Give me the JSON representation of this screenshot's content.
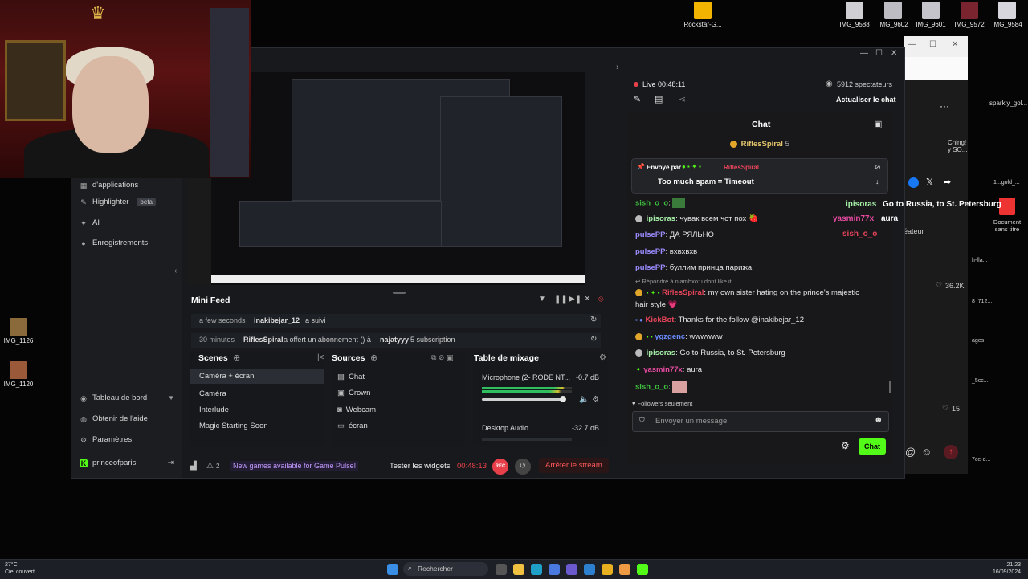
{
  "desktop": {
    "icons_top": [
      {
        "label": "Rockstar-G..."
      },
      {
        "label": "IMG_9588"
      },
      {
        "label": "IMG_9602"
      },
      {
        "label": "IMG_9601"
      },
      {
        "label": "IMG_9572"
      },
      {
        "label": "IMG_9584"
      }
    ],
    "icons_left": [
      {
        "label": "IMG_1126"
      },
      {
        "label": "IMG_1120"
      }
    ],
    "right_doc_label": "Document sans titre",
    "right_user": "sparkly_gol...",
    "right_likes": "36.2K",
    "right_likes2": "15",
    "right_snippets": [
      "Ching! y SO...",
      "éateur",
      "1...gold_...",
      "h-fla...",
      "8_712...",
      "ages",
      "_5cc...",
      "7ce-d..."
    ],
    "right_ellipsis": "···"
  },
  "app": {
    "sidebar": {
      "items": [
        {
          "label": "d'applications"
        },
        {
          "label": "Highlighter",
          "badge": "beta"
        },
        {
          "label": "AI"
        },
        {
          "label": "Enregistrements"
        }
      ],
      "bottom": [
        {
          "label": "Tableau de bord"
        },
        {
          "label": "Obtenir de l'aide"
        },
        {
          "label": "Paramètres"
        },
        {
          "label": "princeofparis"
        }
      ]
    },
    "minifeed": {
      "title": "Mini Feed",
      "entries": [
        {
          "time": "a few seconds",
          "user": "inakibejar_12",
          "action": "a suivi"
        },
        {
          "time": "30 minutes",
          "user": "RiflesSpiral",
          "action": "a offert un abonnement () à",
          "target": "najatyyy",
          "extra": "5 subscription"
        }
      ]
    },
    "scenes": {
      "title": "Scenes",
      "items": [
        "Caméra + écran",
        "Caméra",
        "Interlude",
        "Magic Starting Soon"
      ]
    },
    "sources": {
      "title": "Sources",
      "items": [
        "Chat",
        "Crown",
        "Webcam",
        "écran"
      ]
    },
    "mixer": {
      "title": "Table de mixage",
      "channels": [
        {
          "name": "Microphone (2- RODE NT...",
          "db": "-0.7 dB"
        },
        {
          "name": "Desktop Audio",
          "db": "-32.7 dB"
        }
      ]
    },
    "footer": {
      "viewer_count": "2",
      "news": "New games available for Game Pulse!",
      "test_widgets": "Tester les widgets",
      "timer": "00:48:13",
      "rec": "REC",
      "stop": "Arrêter le stream"
    },
    "live": {
      "status": "Live 00:48:11",
      "viewers": "5912 spectateurs",
      "refresh": "Actualiser le chat"
    },
    "chat": {
      "title": "Chat",
      "top_sub_user": "RiflesSpiral",
      "top_sub_count": "5",
      "pinned_prefix": "Envoyé par",
      "pinned_user": "RiflesSpiral",
      "pinned_message": "Too much spam = Timeout",
      "overlay_right": [
        {
          "user": "ipisoras",
          "text": "Go to Russia, to St. Petersburg"
        },
        {
          "user": "yasmin77x",
          "text": "aura"
        },
        {
          "user": "sish_o_o",
          "text": ""
        }
      ],
      "messages": [
        {
          "user": "sish_o_o",
          "text": "",
          "color": "#3fbf3f"
        },
        {
          "user": "ipisoras",
          "text": "чувак всем чот пох 🍓",
          "color": "#a7f0a7"
        },
        {
          "user": "pulsePP",
          "text": "ДА РЯЛЬНО",
          "color": "#9b8cff"
        },
        {
          "user": "pulsePP",
          "text": "вхвхвхв",
          "color": "#9b8cff"
        },
        {
          "user": "pulsePP",
          "text": "буллим принца парижа",
          "color": "#9b8cff"
        },
        {
          "reply": "Répondre à nlamhxo: i dont like it"
        },
        {
          "user": "RiflesSpiral",
          "text": "my own sister hating on the prince's majestic",
          "color": "#e8455a"
        },
        {
          "text": "hair style 💗"
        },
        {
          "user": "KickBot",
          "text": "Thanks for the follow @inakibejar_12",
          "color": "#e8455a"
        },
        {
          "user": "ygzgenc",
          "text": "wwwwww",
          "color": "#6a8cff"
        },
        {
          "user": "ipisoras",
          "text": "Go to Russia, to St. Petersburg",
          "color": "#a7f0a7"
        },
        {
          "user": "yasmin77x",
          "text": "aura",
          "color": "#e84aa0"
        },
        {
          "user": "sish_o_o",
          "text": "",
          "color": "#3fbf3f"
        }
      ],
      "followers_only": "Followers seulement",
      "input_placeholder": "Envoyer un message",
      "send_label": "Chat"
    }
  },
  "browser_bg": {
    "window_controls": [
      "—",
      "☐",
      "✕"
    ]
  },
  "taskbar": {
    "weather_temp": "27°C",
    "weather_desc": "Ciel couvert",
    "search": "Rechercher",
    "time": "21:23",
    "date": "16/09/2024"
  },
  "colors": {
    "accent": "#53fc18",
    "live_red": "#e8404a",
    "name_red": "#e8455a",
    "brand_green": "#53fc18"
  }
}
